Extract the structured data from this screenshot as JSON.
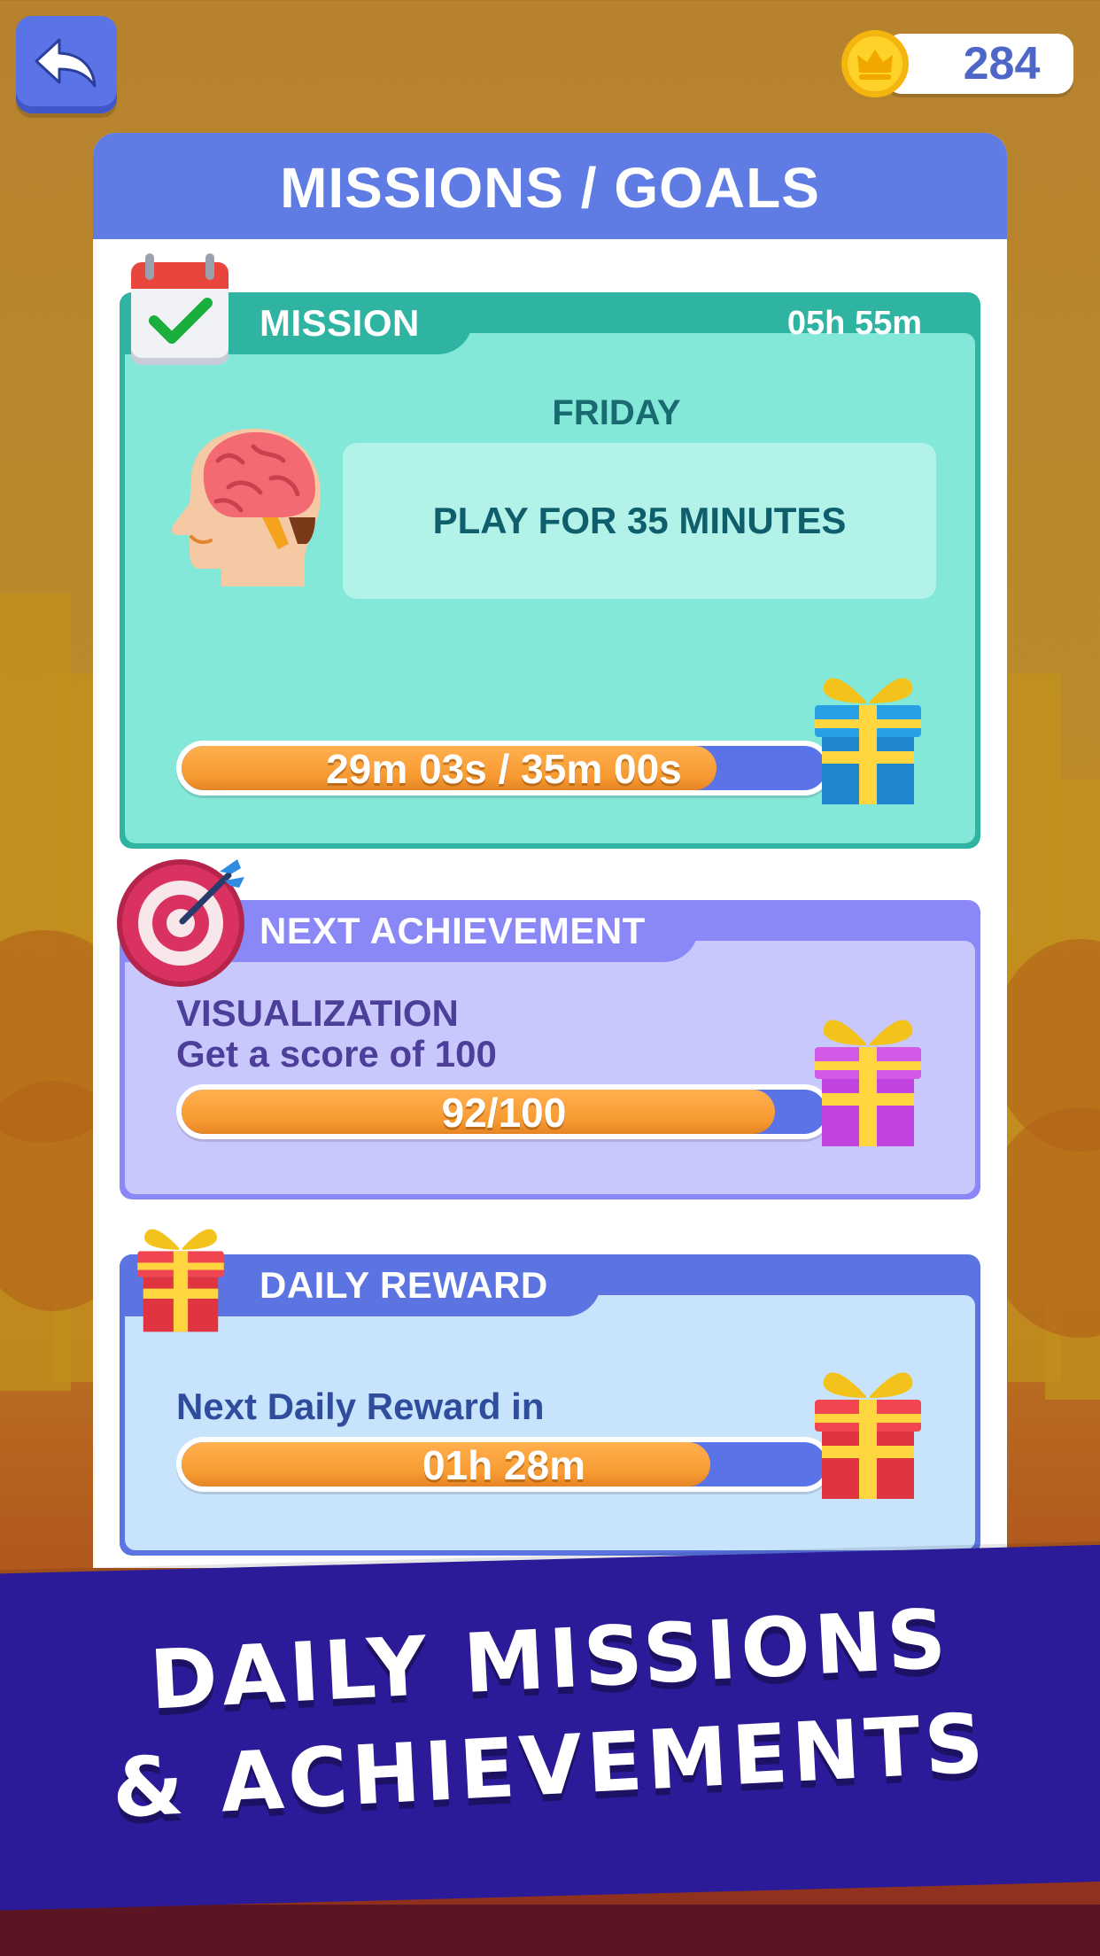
{
  "top_bar": {
    "coins": "284"
  },
  "panel": {
    "title": "MISSIONS / GOALS"
  },
  "mission": {
    "tab_label": "MISSION",
    "timer": "05h 55m",
    "day": "FRIDAY",
    "task": "PLAY FOR 35 MINUTES",
    "progress_text": "29m 03s / 35m 00s",
    "progress_fraction": 0.83
  },
  "achievement": {
    "tab_label": "NEXT ACHIEVEMENT",
    "title": "VISUALIZATION",
    "description": "Get a score of 100",
    "progress_text": "92/100",
    "progress_fraction": 0.92
  },
  "daily": {
    "tab_label": "DAILY REWARD",
    "text": "Next Daily Reward in",
    "progress_text": "01h 28m",
    "progress_fraction": 0.82
  },
  "banner": {
    "line1": "DAILY MISSIONS",
    "line2": "& ACHIEVEMENTS"
  },
  "icons": {
    "back": "back-arrow-icon",
    "coin": "crown-coin-icon",
    "calendar": "calendar-check-icon",
    "brain": "brain-head-icon",
    "target": "target-dart-icon",
    "gift": "gift-box-icon"
  },
  "colors": {
    "mission": "#2fb4a2",
    "achievement": "#8a88f6",
    "daily": "#5b74e2",
    "progress": "#f79a32",
    "banner": "#2b1b98"
  }
}
